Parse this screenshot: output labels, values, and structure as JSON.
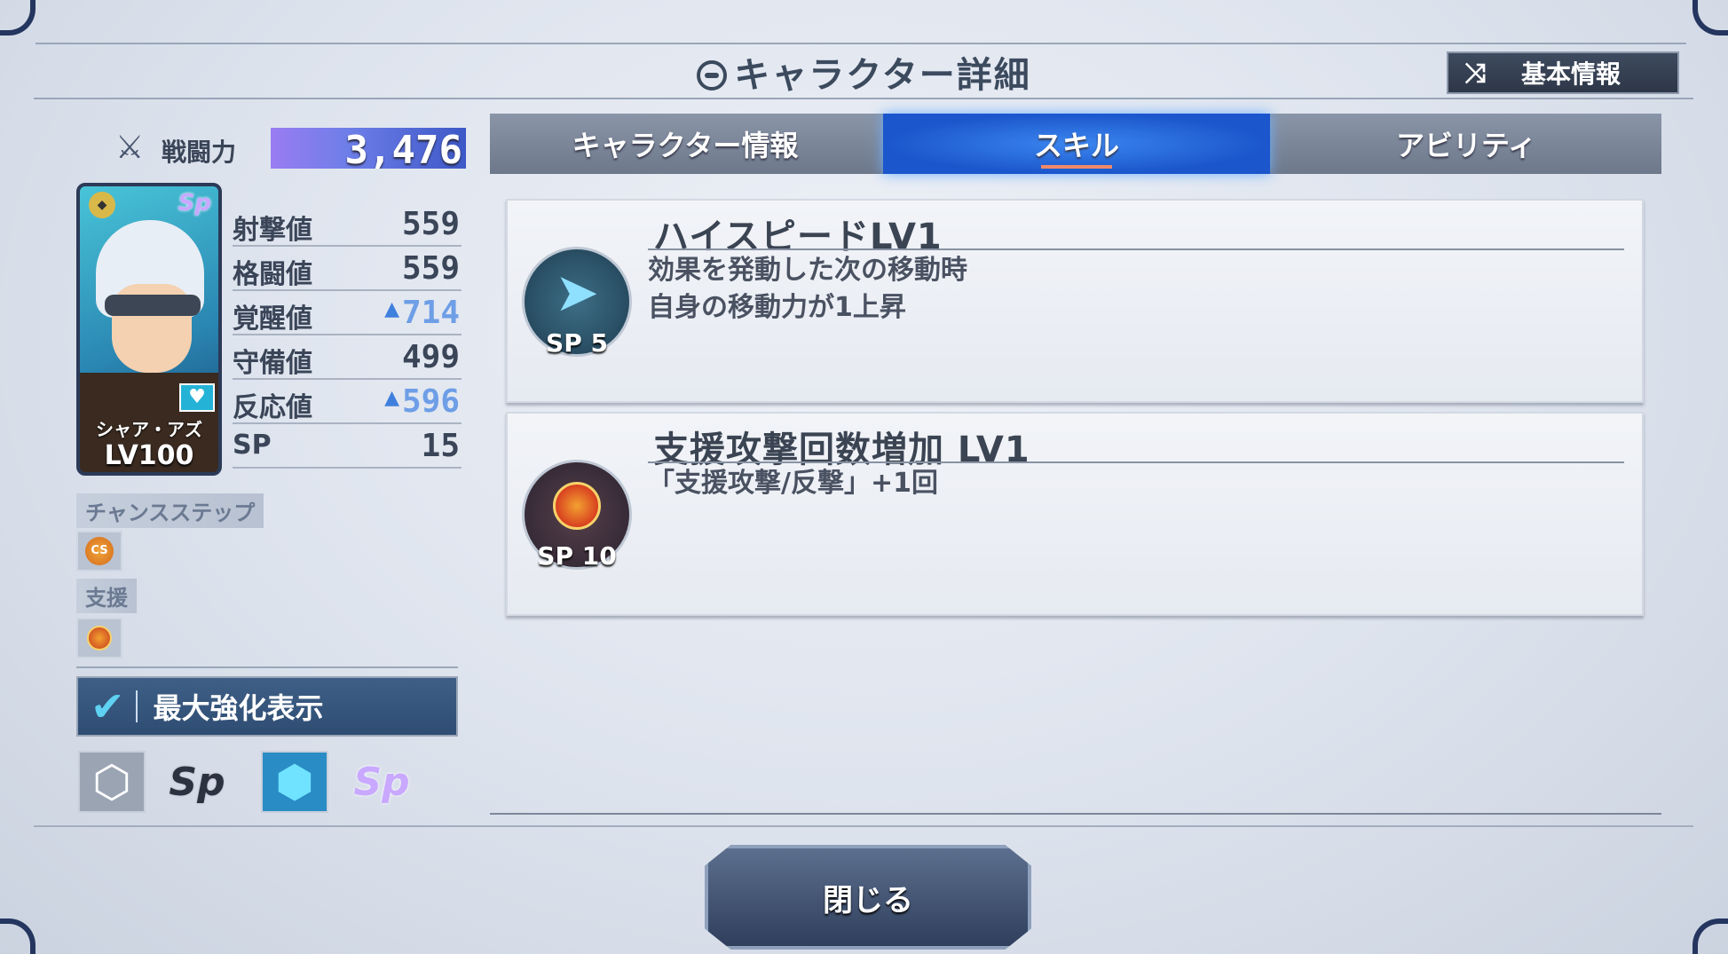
{
  "header": {
    "title": "キャラクター詳細",
    "basic_info_button": "基本情報"
  },
  "power": {
    "label": "戦闘力",
    "value": "3,476"
  },
  "card": {
    "name": "シャア・アズ",
    "level": "LV100",
    "sp_badge": "Sp"
  },
  "stats": [
    {
      "label": "射撃値",
      "value": "559",
      "boosted": false
    },
    {
      "label": "格闘値",
      "value": "559",
      "boosted": false
    },
    {
      "label": "覚醒値",
      "value": "714",
      "boosted": true
    },
    {
      "label": "守備値",
      "value": "499",
      "boosted": false
    },
    {
      "label": "反応値",
      "value": "596",
      "boosted": true
    },
    {
      "label": "SP",
      "value": "15",
      "boosted": false
    }
  ],
  "chance_step": {
    "label": "チャンスステップ",
    "icon_text": "CS"
  },
  "support": {
    "label": "支援"
  },
  "max_enhance": {
    "label": "最大強化表示",
    "checked": true
  },
  "tabs": [
    {
      "label": "キャラクター情報",
      "active": false
    },
    {
      "label": "スキル",
      "active": true
    },
    {
      "label": "アビリティ",
      "active": false
    }
  ],
  "skills": [
    {
      "name": "ハイスピードLV1",
      "description": "効果を発動した次の移動時\n自身の移動力が1上昇",
      "sp": "SP 5",
      "icon": "boot-icon"
    },
    {
      "name": "支援攻撃回数増加 LV1",
      "description": "「支援攻撃/反撃」+1回",
      "sp": "SP 10",
      "icon": "bullet-icon"
    }
  ],
  "footer": {
    "close_button": "閉じる"
  },
  "colors": {
    "accent_blue": "#1b56cc",
    "boost_blue": "#6e9ee6",
    "frame_dark": "#24365f"
  }
}
